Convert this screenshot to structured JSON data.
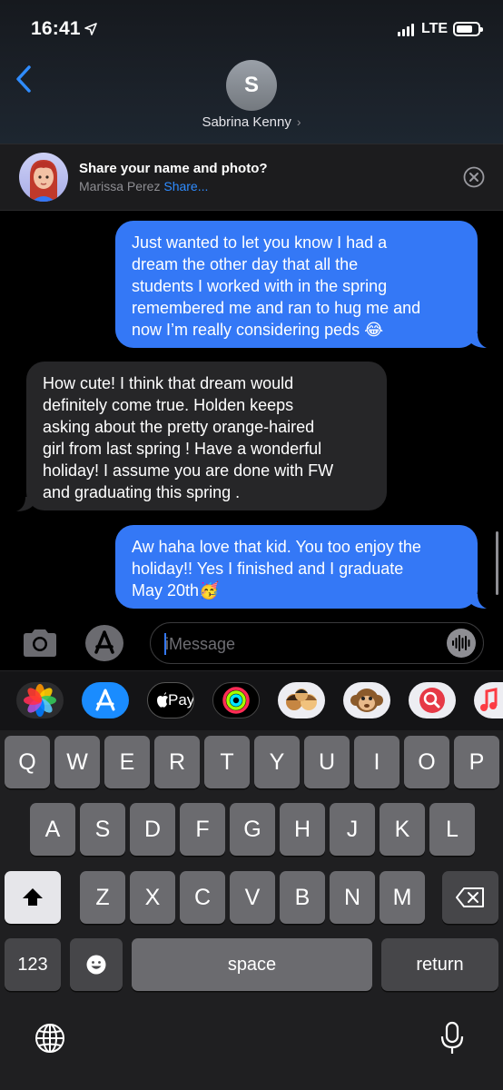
{
  "status": {
    "time": "16:41",
    "network": "LTE"
  },
  "header": {
    "contact_initial": "S",
    "contact_name": "Sabrina Kenny",
    "chevron": "›"
  },
  "share_banner": {
    "title": "Share your name and photo?",
    "name": "Marissa Perez",
    "action": "Share..."
  },
  "messages": [
    {
      "direction": "outgoing",
      "lines": [
        "Just wanted to let you know I had a",
        "dream the other day that all the",
        "students I worked with in the spring",
        "remembered me and ran to hug me and",
        "now I’m really considering peds 😂"
      ]
    },
    {
      "direction": "incoming",
      "lines": [
        "How cute! I think that dream would",
        "definitely come true. Holden keeps",
        "asking about the pretty orange-haired",
        "girl from last spring ! Have a wonderful",
        "holiday! I assume you are done with FW",
        "and graduating this spring ."
      ]
    },
    {
      "direction": "outgoing",
      "lines": [
        "Aw haha love that kid. You too enjoy the",
        "holiday!! Yes I finished and I graduate",
        "May 20th🥳"
      ]
    }
  ],
  "compose": {
    "placeholder": "iMessage"
  },
  "app_drawer": {
    "apple_pay_label": "Pay",
    "icons": [
      "photos-icon",
      "app-store-icon",
      "apple-pay-icon",
      "activity-icon",
      "memoji-icon",
      "animoji-monkey-icon",
      "web-search-icon",
      "music-icon"
    ]
  },
  "keyboard": {
    "row1": [
      "Q",
      "W",
      "E",
      "R",
      "T",
      "Y",
      "U",
      "I",
      "O",
      "P"
    ],
    "row2": [
      "A",
      "S",
      "D",
      "F",
      "G",
      "H",
      "J",
      "K",
      "L"
    ],
    "row3": [
      "Z",
      "X",
      "C",
      "V",
      "B",
      "N",
      "M"
    ],
    "numbers_label": "123",
    "space_label": "space",
    "return_label": "return"
  },
  "colors": {
    "outgoing_bubble": "#3478f6",
    "incoming_bubble": "#262628",
    "link": "#2f8cff"
  }
}
